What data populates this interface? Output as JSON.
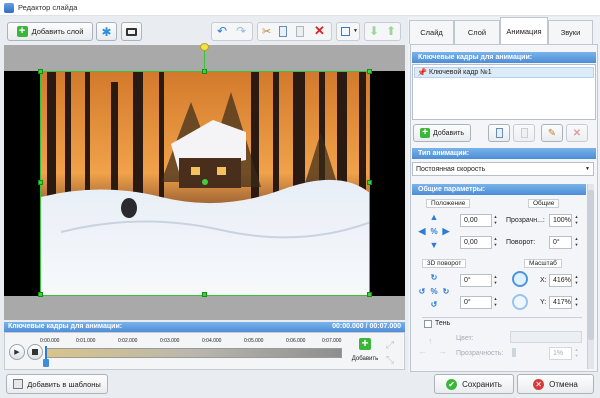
{
  "window": {
    "title": "Редактор слайда"
  },
  "toolbar": {
    "add_layer_label": "Добавить слой"
  },
  "tabs": [
    {
      "label": "Слайд",
      "active": false
    },
    {
      "label": "Слой",
      "active": false
    },
    {
      "label": "Анимация",
      "active": true
    },
    {
      "label": "Звуки",
      "active": false
    }
  ],
  "panel": {
    "keyframes_title": "Ключевые кадры для анимации:",
    "keyframe_item": "Ключевой кадр №1",
    "add_button_label": "Добавить",
    "anim_type_title": "Тип анимации:",
    "anim_type_value": "Постоянная скорость",
    "general_title": "Общие параметры:",
    "position": {
      "title": "Положение",
      "x": "0,00",
      "y": "0,00"
    },
    "common": {
      "title": "Общие",
      "opacity_label": "Прозрачн...:",
      "opacity_value": "100%",
      "rotation_label": "Поворот:",
      "rotation_value": "0°"
    },
    "rotation3d": {
      "title": "3D поворот",
      "a": "0°",
      "b": "0°"
    },
    "scale": {
      "title": "Масштаб",
      "x_label": "X:",
      "x_value": "416%",
      "y_label": "Y:",
      "y_value": "417%"
    },
    "shadow": {
      "label": "Тень",
      "color_label": "Цвет:",
      "transparency_label": "Прозрачность:",
      "transparency_value": "1%"
    }
  },
  "timeline": {
    "title": "Ключевые кадры для анимации:",
    "time": "00:00.000 / 00:07.000",
    "ticks": [
      "0:00.000",
      "0:01.000",
      "0:02.000",
      "0:03.000",
      "0:04.000",
      "0:05.000",
      "0:06.000",
      "0:07.000"
    ],
    "add_label": "Добавить"
  },
  "footer": {
    "templates_label": "Добавить в шаблоны",
    "save_label": "Сохранить",
    "cancel_label": "Отмена"
  },
  "colors": {
    "accent": "#4f8fd8",
    "selection": "#39c437"
  }
}
